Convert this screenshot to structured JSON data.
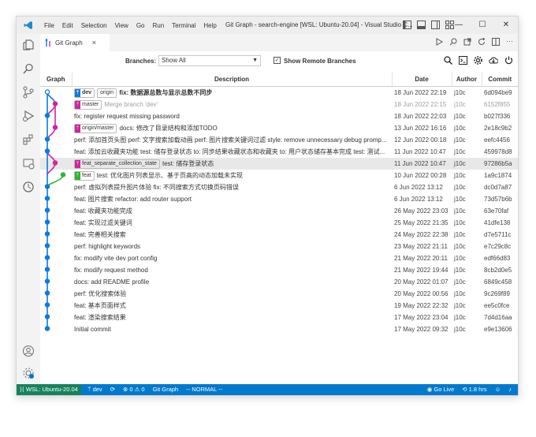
{
  "window": {
    "title": "Git Graph - search-engine [WSL: Ubuntu-20.04] - Visual Studio C...",
    "menu": [
      "File",
      "Edit",
      "Selection",
      "View",
      "Go",
      "Run",
      "Terminal",
      "Help"
    ]
  },
  "tab": {
    "label": "Git Graph",
    "close": "×"
  },
  "toolbar": {
    "branches_label": "Branches:",
    "branches_value": "Show All",
    "show_remote_label": "Show Remote Branches",
    "show_remote_checked": "✓"
  },
  "columns": {
    "graph": "Graph",
    "description": "Description",
    "date": "Date",
    "author": "Author",
    "commit": "Commit"
  },
  "commits": [
    {
      "refs": [
        {
          "name": "dev",
          "color": "blue",
          "head": true
        },
        {
          "name": "origin",
          "color": "none"
        }
      ],
      "message": "fix: 数据源总数与显示总数不同步",
      "date": "18 Jun 2022 22:19",
      "author": "j10c",
      "hash": "6d094be9"
    },
    {
      "refs": [
        {
          "name": "master",
          "color": "pink"
        }
      ],
      "message": "Merge branch 'dev'",
      "date": "18 Jun 2022 22:15",
      "author": "j10c",
      "hash": "6152f855"
    },
    {
      "refs": [],
      "message": "fix: register request missing password",
      "date": "18 Jun 2022 22:03",
      "author": "j10c",
      "hash": "b027f336"
    },
    {
      "refs": [
        {
          "name": "origin/master",
          "color": "pink"
        }
      ],
      "message": "docs: 修改了目录结构和添加TODO",
      "date": "13 Jun 2022 16:16",
      "author": "j10c",
      "hash": "2e18c9b2"
    },
    {
      "refs": [],
      "message": "perf: 添加首页头图 perf: 文字搜索加载动画 perf: 图片搜索关键词过滤 style: remove unnecessary debug promp...",
      "date": "12 Jun 2022 00:18",
      "author": "j10c",
      "hash": "eefc4456"
    },
    {
      "refs": [],
      "message": "feat: 添加云收藏夹功能 test: 储存登录状态 to: 同步结果收藏状态和收藏夹 to: 用户状态储存基本完成 test: 测试...",
      "date": "11 Jun 2022 10:47",
      "author": "j10c",
      "hash": "459978d8"
    },
    {
      "refs": [
        {
          "name": "feat_separate_collection_state",
          "color": "pink"
        }
      ],
      "message": "test: 储存登录状态",
      "date": "11 Jun 2022 10:47",
      "author": "j10c",
      "hash": "97286b5a"
    },
    {
      "refs": [
        {
          "name": "feat",
          "color": "green"
        }
      ],
      "message": "test: 优化图片列表显示、基于页高的动态加载未实现",
      "date": "10 Jun 2022 00:28",
      "author": "j10c",
      "hash": "1a9c1874"
    },
    {
      "refs": [],
      "message": "perf: 虚拟列表提升图片体验 fix: 不同搜索方式切换页码错误",
      "date": "6 Jun 2022 13:12",
      "author": "j10c",
      "hash": "dc0d7a87"
    },
    {
      "refs": [],
      "message": "feat: 图片搜索 refactor: add router support",
      "date": "6 Jun 2022 13:12",
      "author": "j10c",
      "hash": "73d57b6b"
    },
    {
      "refs": [],
      "message": "feat: 收藏夹功能完成",
      "date": "26 May 2022 23:03",
      "author": "j10c",
      "hash": "63e70faf"
    },
    {
      "refs": [],
      "message": "feat: 实现过滤关键词",
      "date": "25 May 2022 21:35",
      "author": "j10c",
      "hash": "41dfe138"
    },
    {
      "refs": [],
      "message": "feat: 完善相关搜索",
      "date": "24 May 2022 22:38",
      "author": "j10c",
      "hash": "d7e5711c"
    },
    {
      "refs": [],
      "message": "perf: highlight keywords",
      "date": "23 May 2022 21:11",
      "author": "j10c",
      "hash": "e7c29c8c"
    },
    {
      "refs": [],
      "message": "fix: modify vite dev port config",
      "date": "21 May 2022 20:11",
      "author": "j10c",
      "hash": "edf66d83"
    },
    {
      "refs": [],
      "message": "fix: modify request method",
      "date": "21 May 2022 19:44",
      "author": "j10c",
      "hash": "8cb2d0e5"
    },
    {
      "refs": [],
      "message": "docs: add README profile",
      "date": "20 May 2022 01:07",
      "author": "j10c",
      "hash": "6849c458"
    },
    {
      "refs": [],
      "message": "perf: 优化搜索体验",
      "date": "20 May 2022 00:56",
      "author": "j10c",
      "hash": "9c269f89"
    },
    {
      "refs": [],
      "message": "feat: 基本页面样式",
      "date": "19 May 2022 22:32",
      "author": "j10c",
      "hash": "ee5c0fce"
    },
    {
      "refs": [],
      "message": "feat: 渲染搜索结果",
      "date": "17 May 2022 23:04",
      "author": "j10c",
      "hash": "7d4d16aa"
    },
    {
      "refs": [],
      "message": "Initial commit",
      "date": "17 May 2022 09:32",
      "author": "j10c",
      "hash": "e9e13606"
    }
  ],
  "graph_colors": {
    "main": "#0d7bdc",
    "master": "#d0259f",
    "feat": "#2eb62e"
  },
  "statusbar": {
    "remote": "WSL: Ubuntu-20.04",
    "branch": "dev",
    "problems": "⊗ 0 ⚠ 0",
    "git_graph": "Git Graph",
    "mode": "-- NORMAL --",
    "go_live": "Go Live",
    "time": "1.8 hrs"
  },
  "accent": "#007acc"
}
